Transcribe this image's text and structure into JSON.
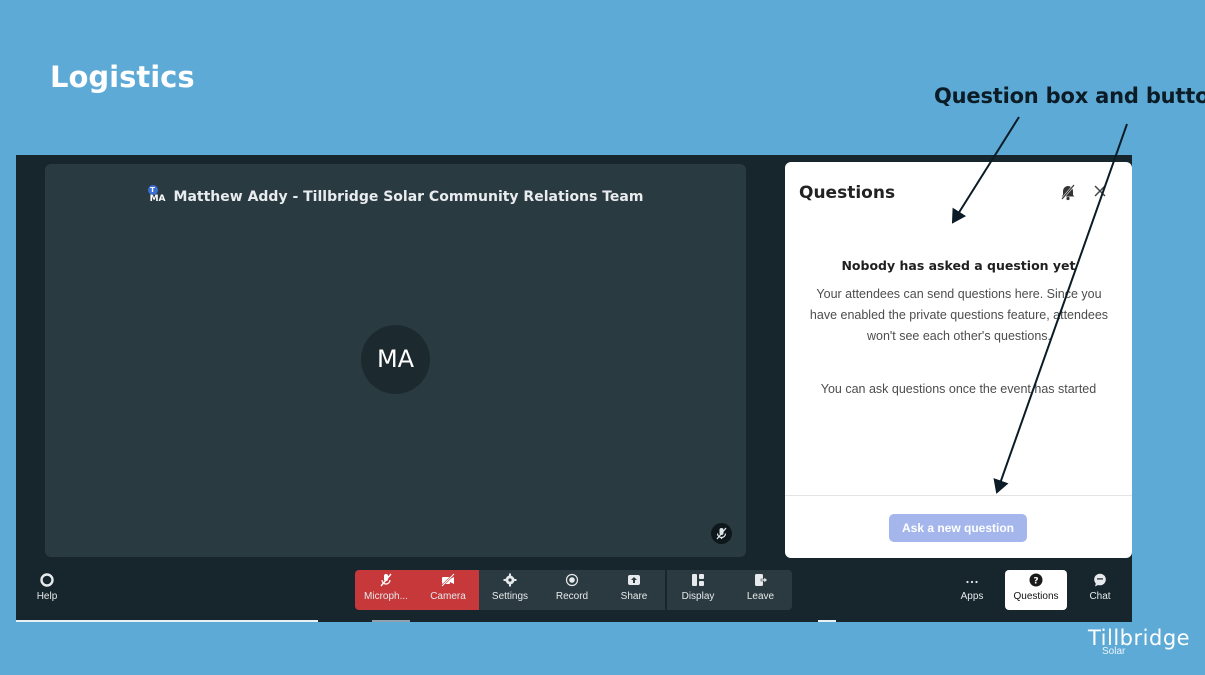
{
  "slide": {
    "title": "Logistics",
    "callout": "Question box and button"
  },
  "meeting": {
    "participant_initials_badge": "MA",
    "participant_badge_dot": "T",
    "participant_name": "Matthew Addy - Tillbridge Solar Community Relations Team",
    "avatar_initials": "MA"
  },
  "questions_panel": {
    "title": "Questions",
    "empty_title": "Nobody has asked a question yet",
    "empty_description": "Your attendees can send questions here. Since you have enabled the private questions feature, attendees won't see each other's questions.",
    "empty_note": "You can ask questions once the event has started",
    "ask_button_label": "Ask a new question"
  },
  "toolbar": {
    "help": "Help",
    "microphone": "Microph...",
    "camera": "Camera",
    "settings": "Settings",
    "record": "Record",
    "share": "Share",
    "display": "Display",
    "leave": "Leave",
    "apps": "Apps",
    "questions": "Questions",
    "chat": "Chat"
  },
  "brand": {
    "logo_main": "Tillbridge",
    "logo_sub": "Solar"
  },
  "colors": {
    "slide_bg": "#5eaad6",
    "stage_bg": "#17262d",
    "muted_red": "#c7383a",
    "ask_button": "#a4b6ec"
  }
}
